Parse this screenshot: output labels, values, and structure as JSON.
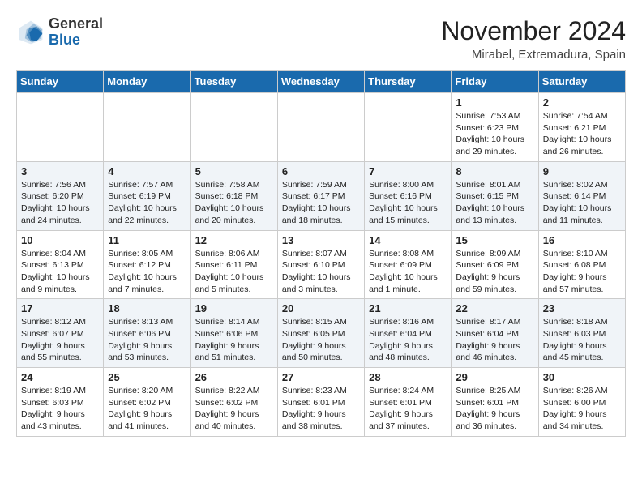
{
  "header": {
    "logo": {
      "general": "General",
      "blue": "Blue"
    },
    "title": "November 2024",
    "location": "Mirabel, Extremadura, Spain"
  },
  "days_of_week": [
    "Sunday",
    "Monday",
    "Tuesday",
    "Wednesday",
    "Thursday",
    "Friday",
    "Saturday"
  ],
  "weeks": [
    [
      {
        "day": "",
        "text": ""
      },
      {
        "day": "",
        "text": ""
      },
      {
        "day": "",
        "text": ""
      },
      {
        "day": "",
        "text": ""
      },
      {
        "day": "",
        "text": ""
      },
      {
        "day": "1",
        "text": "Sunrise: 7:53 AM\nSunset: 6:23 PM\nDaylight: 10 hours and 29 minutes."
      },
      {
        "day": "2",
        "text": "Sunrise: 7:54 AM\nSunset: 6:21 PM\nDaylight: 10 hours and 26 minutes."
      }
    ],
    [
      {
        "day": "3",
        "text": "Sunrise: 7:56 AM\nSunset: 6:20 PM\nDaylight: 10 hours and 24 minutes."
      },
      {
        "day": "4",
        "text": "Sunrise: 7:57 AM\nSunset: 6:19 PM\nDaylight: 10 hours and 22 minutes."
      },
      {
        "day": "5",
        "text": "Sunrise: 7:58 AM\nSunset: 6:18 PM\nDaylight: 10 hours and 20 minutes."
      },
      {
        "day": "6",
        "text": "Sunrise: 7:59 AM\nSunset: 6:17 PM\nDaylight: 10 hours and 18 minutes."
      },
      {
        "day": "7",
        "text": "Sunrise: 8:00 AM\nSunset: 6:16 PM\nDaylight: 10 hours and 15 minutes."
      },
      {
        "day": "8",
        "text": "Sunrise: 8:01 AM\nSunset: 6:15 PM\nDaylight: 10 hours and 13 minutes."
      },
      {
        "day": "9",
        "text": "Sunrise: 8:02 AM\nSunset: 6:14 PM\nDaylight: 10 hours and 11 minutes."
      }
    ],
    [
      {
        "day": "10",
        "text": "Sunrise: 8:04 AM\nSunset: 6:13 PM\nDaylight: 10 hours and 9 minutes."
      },
      {
        "day": "11",
        "text": "Sunrise: 8:05 AM\nSunset: 6:12 PM\nDaylight: 10 hours and 7 minutes."
      },
      {
        "day": "12",
        "text": "Sunrise: 8:06 AM\nSunset: 6:11 PM\nDaylight: 10 hours and 5 minutes."
      },
      {
        "day": "13",
        "text": "Sunrise: 8:07 AM\nSunset: 6:10 PM\nDaylight: 10 hours and 3 minutes."
      },
      {
        "day": "14",
        "text": "Sunrise: 8:08 AM\nSunset: 6:09 PM\nDaylight: 10 hours and 1 minute."
      },
      {
        "day": "15",
        "text": "Sunrise: 8:09 AM\nSunset: 6:09 PM\nDaylight: 9 hours and 59 minutes."
      },
      {
        "day": "16",
        "text": "Sunrise: 8:10 AM\nSunset: 6:08 PM\nDaylight: 9 hours and 57 minutes."
      }
    ],
    [
      {
        "day": "17",
        "text": "Sunrise: 8:12 AM\nSunset: 6:07 PM\nDaylight: 9 hours and 55 minutes."
      },
      {
        "day": "18",
        "text": "Sunrise: 8:13 AM\nSunset: 6:06 PM\nDaylight: 9 hours and 53 minutes."
      },
      {
        "day": "19",
        "text": "Sunrise: 8:14 AM\nSunset: 6:06 PM\nDaylight: 9 hours and 51 minutes."
      },
      {
        "day": "20",
        "text": "Sunrise: 8:15 AM\nSunset: 6:05 PM\nDaylight: 9 hours and 50 minutes."
      },
      {
        "day": "21",
        "text": "Sunrise: 8:16 AM\nSunset: 6:04 PM\nDaylight: 9 hours and 48 minutes."
      },
      {
        "day": "22",
        "text": "Sunrise: 8:17 AM\nSunset: 6:04 PM\nDaylight: 9 hours and 46 minutes."
      },
      {
        "day": "23",
        "text": "Sunrise: 8:18 AM\nSunset: 6:03 PM\nDaylight: 9 hours and 45 minutes."
      }
    ],
    [
      {
        "day": "24",
        "text": "Sunrise: 8:19 AM\nSunset: 6:03 PM\nDaylight: 9 hours and 43 minutes."
      },
      {
        "day": "25",
        "text": "Sunrise: 8:20 AM\nSunset: 6:02 PM\nDaylight: 9 hours and 41 minutes."
      },
      {
        "day": "26",
        "text": "Sunrise: 8:22 AM\nSunset: 6:02 PM\nDaylight: 9 hours and 40 minutes."
      },
      {
        "day": "27",
        "text": "Sunrise: 8:23 AM\nSunset: 6:01 PM\nDaylight: 9 hours and 38 minutes."
      },
      {
        "day": "28",
        "text": "Sunrise: 8:24 AM\nSunset: 6:01 PM\nDaylight: 9 hours and 37 minutes."
      },
      {
        "day": "29",
        "text": "Sunrise: 8:25 AM\nSunset: 6:01 PM\nDaylight: 9 hours and 36 minutes."
      },
      {
        "day": "30",
        "text": "Sunrise: 8:26 AM\nSunset: 6:00 PM\nDaylight: 9 hours and 34 minutes."
      }
    ]
  ]
}
